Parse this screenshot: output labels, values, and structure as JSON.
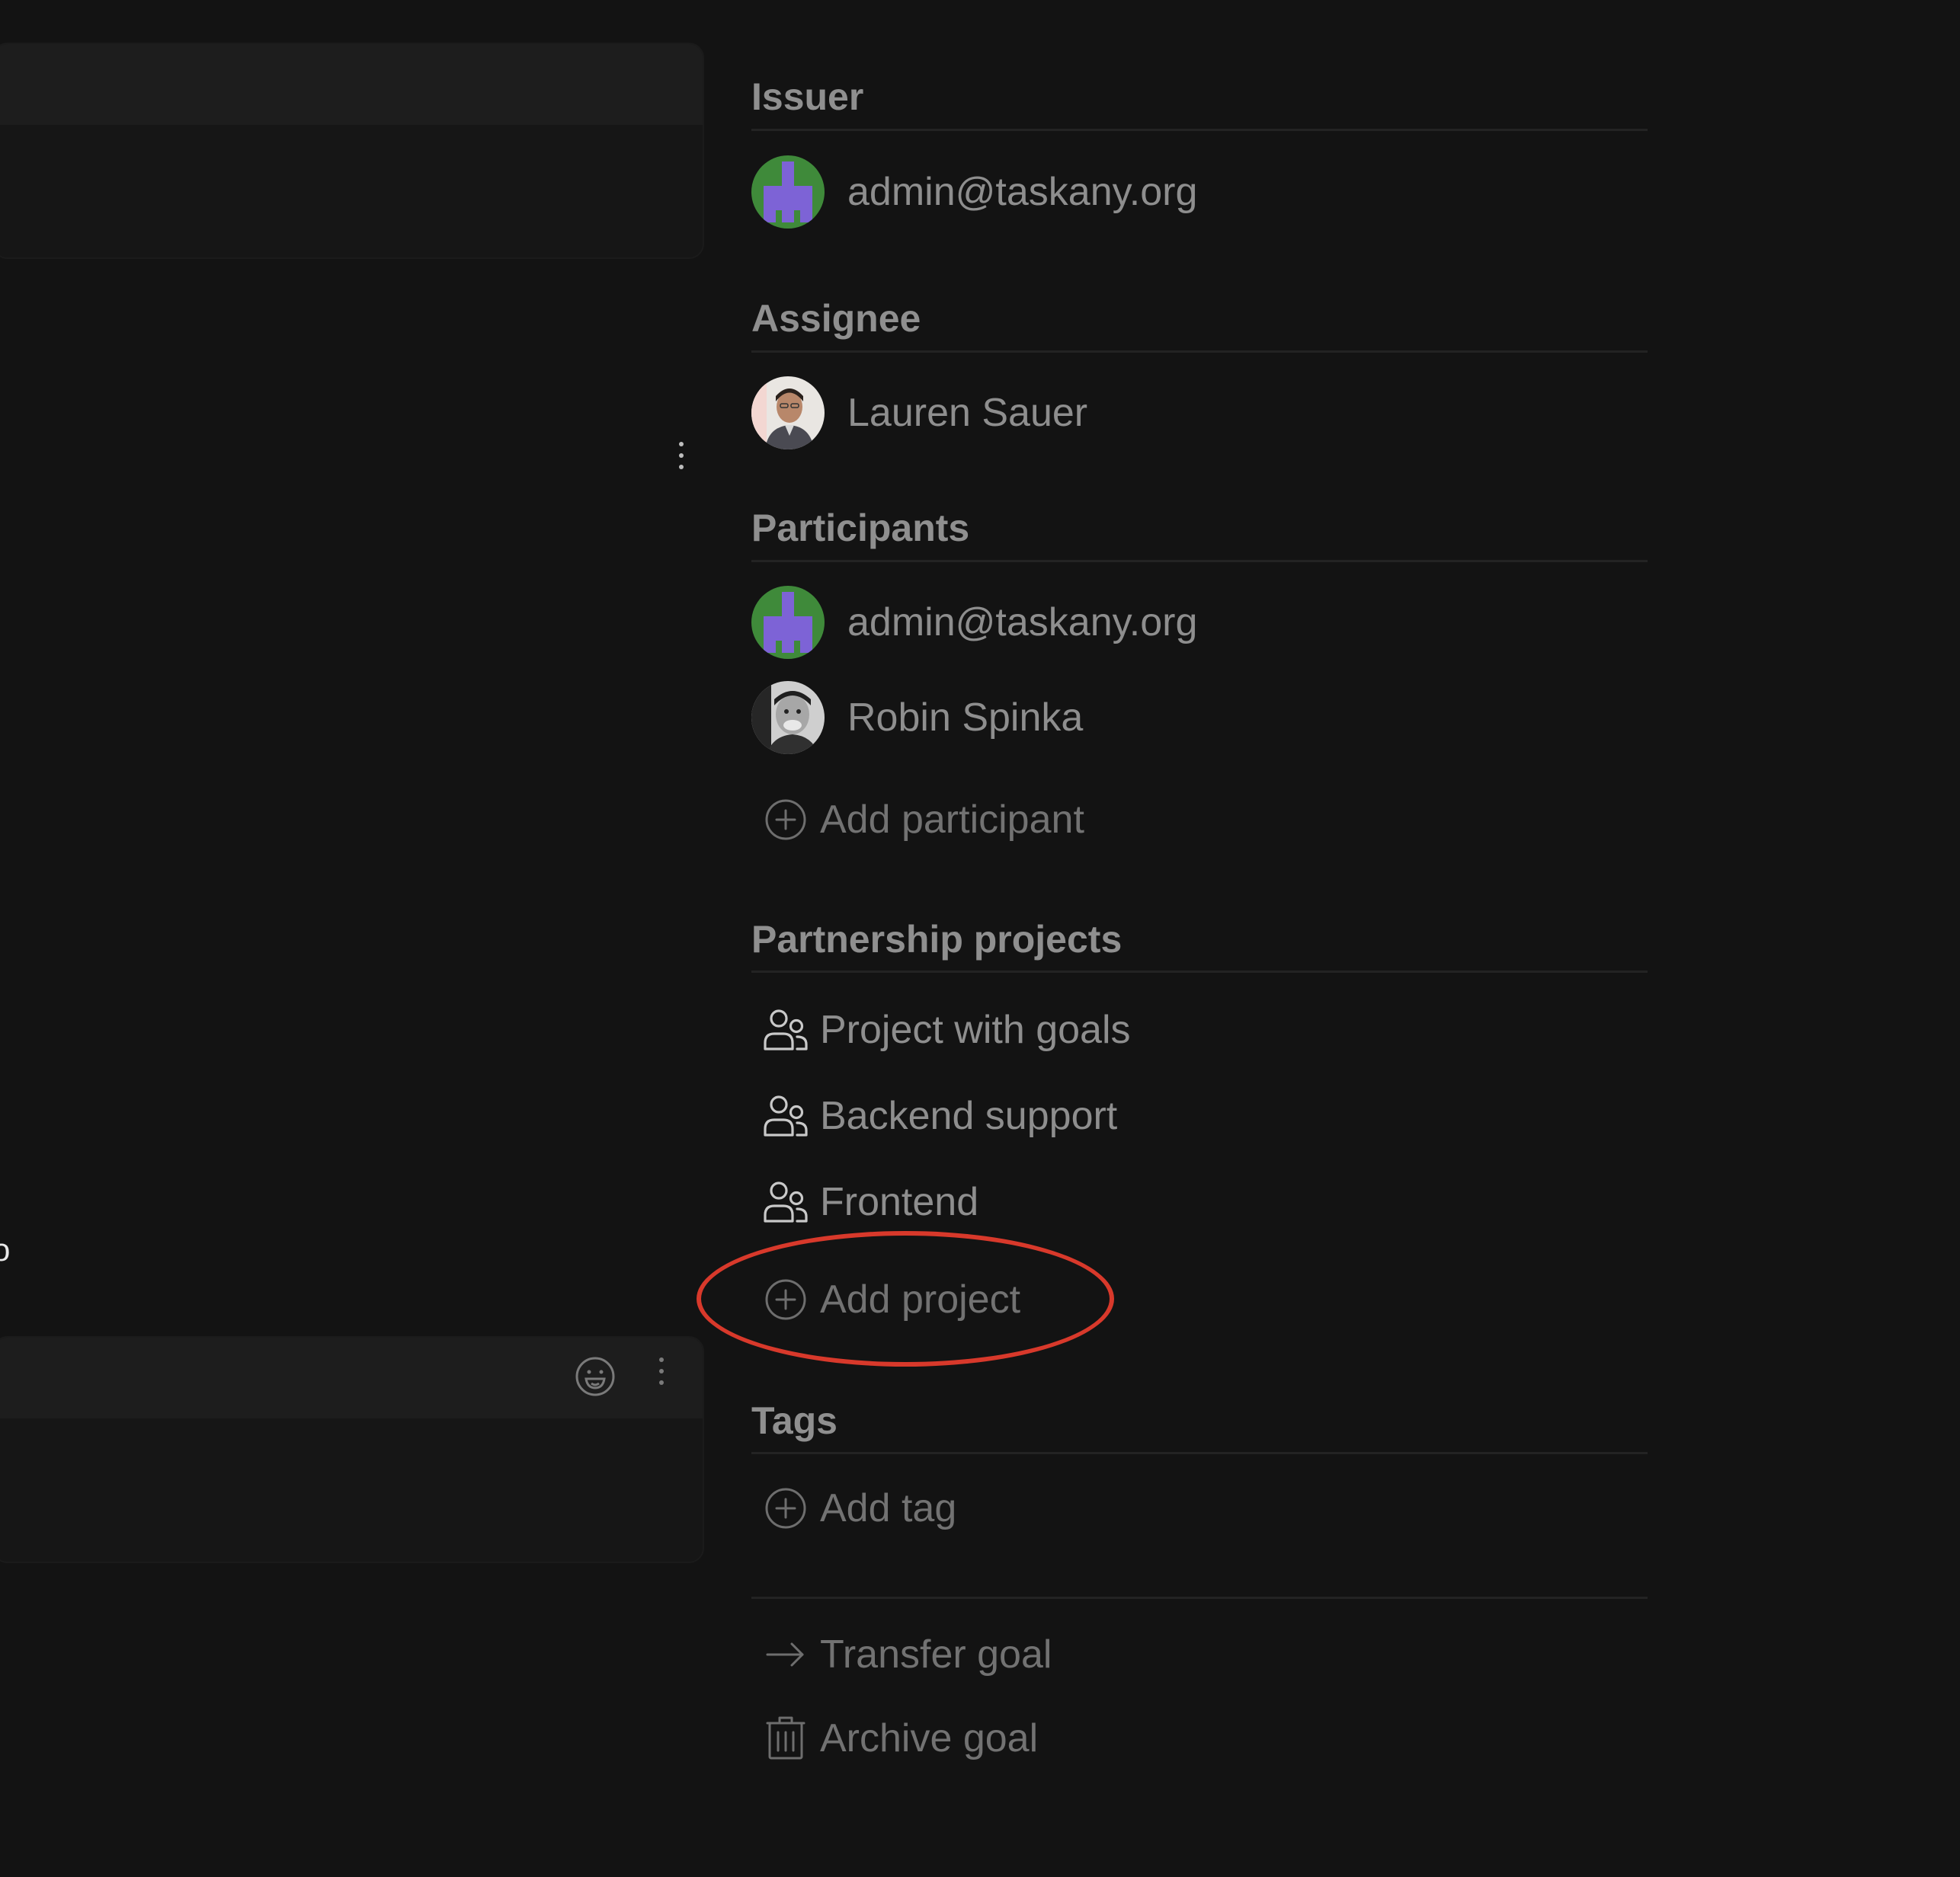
{
  "sidebar": {
    "issuer": {
      "title": "Issuer",
      "user": {
        "label": "admin@taskany.org",
        "avatar": "pixel-avatar-icon"
      }
    },
    "assignee": {
      "title": "Assignee",
      "user": {
        "label": "Lauren Sauer",
        "avatar": "photo-avatar"
      }
    },
    "participants": {
      "title": "Participants",
      "users": [
        {
          "label": "admin@taskany.org",
          "avatar": "pixel-avatar-icon"
        },
        {
          "label": "Robin Spinka",
          "avatar": "photo-avatar"
        }
      ],
      "add_label": "Add participant"
    },
    "projects": {
      "title": "Partnership projects",
      "items": [
        {
          "label": "Project with goals",
          "icon": "users-icon"
        },
        {
          "label": "Backend support",
          "icon": "users-icon"
        },
        {
          "label": "Frontend",
          "icon": "users-icon"
        }
      ],
      "add_label": "Add project"
    },
    "tags": {
      "title": "Tags",
      "add_label": "Add tag"
    },
    "actions": {
      "transfer_label": "Transfer goal",
      "archive_label": "Archive goal"
    }
  },
  "left_pane": {
    "cut_text": "o"
  },
  "colors": {
    "background": "#131313",
    "text_primary": "#8e8e8e",
    "text_muted": "#727272",
    "highlight": "#d8392b",
    "pixel_avatar_bg": "#3f8a3a",
    "pixel_avatar_fg": "#7d63d6"
  }
}
